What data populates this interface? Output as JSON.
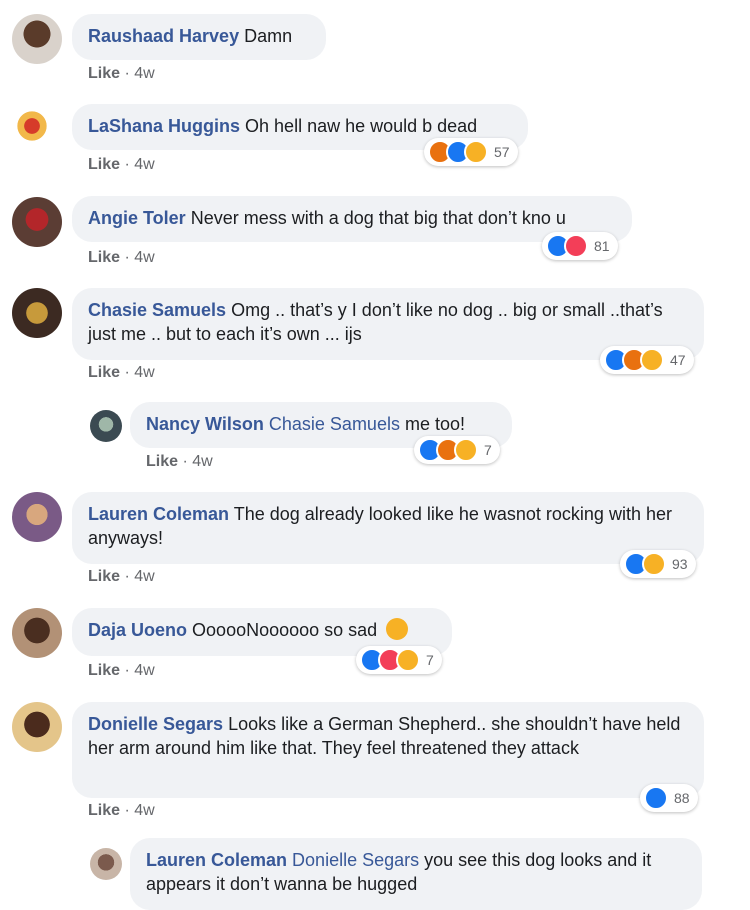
{
  "comments": [
    {
      "name": "Raushaad Harvey",
      "text": "Damn",
      "like": "Like",
      "time": "· 4w"
    },
    {
      "name": "LaShana Huggins",
      "text": "Oh hell naw he would b dead",
      "like": "Like",
      "time": "· 4w",
      "reactions": {
        "count": "57",
        "icons": [
          "angry",
          "like",
          "haha"
        ]
      }
    },
    {
      "name": "Angie Toler",
      "text": "Never mess with a dog that big that don’t kno u",
      "like": "Like",
      "time": "· 4w",
      "reactions": {
        "count": "81",
        "icons": [
          "like",
          "love"
        ]
      }
    },
    {
      "name": "Chasie Samuels",
      "text": "Omg .. that’s y I don’t like no dog .. big or small ..that’s just me .. but to each it’s own ... ijs",
      "like": "Like",
      "time": "· 4w",
      "reactions": {
        "count": "47",
        "icons": [
          "like",
          "angry",
          "haha"
        ]
      }
    },
    {
      "name": "Nancy Wilson",
      "mention": "Chasie Samuels",
      "text": "me too!",
      "like": "Like",
      "time": "· 4w",
      "reactions": {
        "count": "7",
        "icons": [
          "like",
          "angry",
          "haha"
        ]
      }
    },
    {
      "name": "Lauren Coleman",
      "text": "The dog already looked like he wasnot rocking with her anyways!",
      "like": "Like",
      "time": "· 4w",
      "reactions": {
        "count": "93",
        "icons": [
          "like",
          "haha"
        ]
      }
    },
    {
      "name": "Daja Uoeno",
      "text": "OooooNoooooo so sad",
      "like": "Like",
      "time": "· 4w",
      "reactions": {
        "count": "7",
        "icons": [
          "like",
          "love",
          "haha"
        ]
      }
    },
    {
      "name": "Donielle Segars",
      "text": "Looks like a German Shepherd.. she shouldn’t have held her arm around him like that. They feel threatened they attack",
      "like": "Like",
      "time": "· 4w",
      "reactions": {
        "count": "88",
        "icons": [
          "like"
        ]
      }
    },
    {
      "name": "Lauren Coleman",
      "mention": "Donielle Segars",
      "text": "you see this dog looks and it appears it don’t wanna be hugged"
    }
  ],
  "colors": {
    "name": "#385898",
    "bubble": "#f0f2f5",
    "like": "#1877f2",
    "love": "#f33e58",
    "haha": "#f7b125",
    "angry": "#e9710f"
  }
}
